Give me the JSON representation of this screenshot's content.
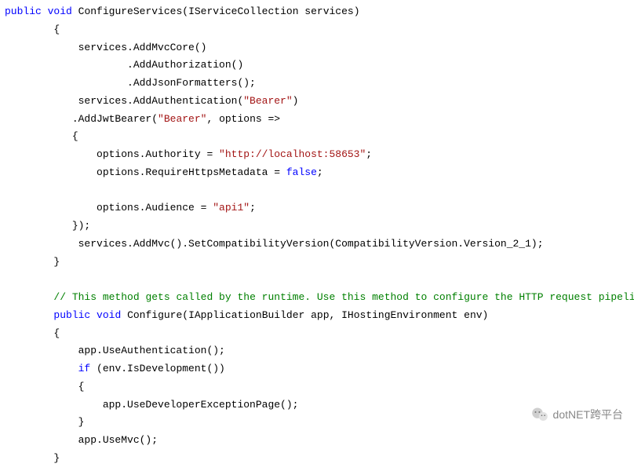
{
  "code": {
    "tokens": [
      [
        "kw",
        "public"
      ],
      [
        "plain",
        " "
      ],
      [
        "kw",
        "void"
      ],
      [
        "plain",
        " ConfigureServices(IServiceCollection services)\n"
      ],
      [
        "plain",
        "        {\n"
      ],
      [
        "plain",
        "            services.AddMvcCore()\n"
      ],
      [
        "plain",
        "                    .AddAuthorization()\n"
      ],
      [
        "plain",
        "                    .AddJsonFormatters();\n"
      ],
      [
        "plain",
        "            services.AddAuthentication("
      ],
      [
        "str",
        "\"Bearer\""
      ],
      [
        "plain",
        ")\n"
      ],
      [
        "plain",
        "           .AddJwtBearer("
      ],
      [
        "str",
        "\"Bearer\""
      ],
      [
        "plain",
        ", options =>\n"
      ],
      [
        "plain",
        "           {\n"
      ],
      [
        "plain",
        "               options.Authority = "
      ],
      [
        "str",
        "\"http://localhost:58653\""
      ],
      [
        "plain",
        ";\n"
      ],
      [
        "plain",
        "               options.RequireHttpsMetadata = "
      ],
      [
        "kw",
        "false"
      ],
      [
        "plain",
        ";\n"
      ],
      [
        "plain",
        "\n"
      ],
      [
        "plain",
        "               options.Audience = "
      ],
      [
        "str",
        "\"api1\""
      ],
      [
        "plain",
        ";\n"
      ],
      [
        "plain",
        "           });\n"
      ],
      [
        "plain",
        "            services.AddMvc().SetCompatibilityVersion(CompatibilityVersion.Version_2_1);\n"
      ],
      [
        "plain",
        "        }\n"
      ],
      [
        "plain",
        "\n"
      ],
      [
        "plain",
        "        "
      ],
      [
        "comment",
        "// This method gets called by the runtime. Use this method to configure the HTTP request pipeline."
      ],
      [
        "plain",
        "\n"
      ],
      [
        "plain",
        "        "
      ],
      [
        "kw",
        "public"
      ],
      [
        "plain",
        " "
      ],
      [
        "kw",
        "void"
      ],
      [
        "plain",
        " Configure(IApplicationBuilder app, IHostingEnvironment env)\n"
      ],
      [
        "plain",
        "        {\n"
      ],
      [
        "plain",
        "            app.UseAuthentication();\n"
      ],
      [
        "plain",
        "            "
      ],
      [
        "kw",
        "if"
      ],
      [
        "plain",
        " (env.IsDevelopment())\n"
      ],
      [
        "plain",
        "            {\n"
      ],
      [
        "plain",
        "                app.UseDeveloperExceptionPage();\n"
      ],
      [
        "plain",
        "            }\n"
      ],
      [
        "plain",
        "            app.UseMvc();\n"
      ],
      [
        "plain",
        "        }"
      ]
    ]
  },
  "watermark": {
    "label": "dotNET跨平台"
  }
}
